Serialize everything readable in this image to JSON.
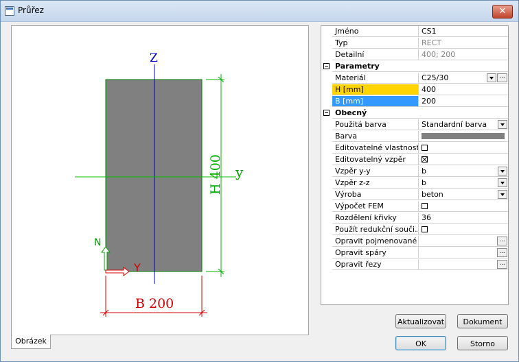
{
  "window": {
    "title": "Průřez",
    "close_label": "✕"
  },
  "drawing": {
    "axis_z": "Z",
    "axis_y": "y",
    "dim_height": "H 400",
    "dim_width": "B 200",
    "lcs_y": "Y",
    "lcs_z": "N",
    "colors": {
      "section": "#808080",
      "outline": "#008000",
      "z_axis": "#0000c0",
      "y_axis": "#00c000",
      "dim": "#00b000",
      "dim_b": "#d00000"
    }
  },
  "tab": {
    "label": "Obrázek"
  },
  "properties": {
    "rows": [
      {
        "type": "item",
        "name": "Jméno",
        "value": "CS1"
      },
      {
        "type": "item",
        "name": "Typ",
        "value": "RECT",
        "readonly": true
      },
      {
        "type": "item",
        "name": "Detailní",
        "value": "400; 200",
        "readonly": true
      },
      {
        "type": "category",
        "name": "Parametry"
      },
      {
        "type": "item",
        "name": "Materiál",
        "value": "C25/30",
        "dropdown": true,
        "dots": true
      },
      {
        "type": "item",
        "name": "H [mm]",
        "value": "400",
        "highlight": "yellow"
      },
      {
        "type": "item",
        "name": "B [mm]",
        "value": "200",
        "highlight": "blue"
      },
      {
        "type": "category",
        "name": "Obecný"
      },
      {
        "type": "item",
        "name": "Použitá barva",
        "value": "Standardní barva",
        "dropdown": true
      },
      {
        "type": "item",
        "name": "Barva",
        "swatch": true
      },
      {
        "type": "item",
        "name": "Editovatelné vlastnosti",
        "checkbox": false
      },
      {
        "type": "item",
        "name": "Editovatelný vzpěr",
        "checkbox": true
      },
      {
        "type": "item",
        "name": "Vzpěr y-y",
        "value": "b",
        "dropdown": true
      },
      {
        "type": "item",
        "name": "Vzpěr z-z",
        "value": "b",
        "dropdown": true
      },
      {
        "type": "item",
        "name": "Výroba",
        "value": "beton",
        "dropdown": true
      },
      {
        "type": "item",
        "name": "Výpočet FEM",
        "checkbox": false
      },
      {
        "type": "item",
        "name": "Rozdělení křivky",
        "value": "36"
      },
      {
        "type": "item",
        "name": "Použít redukční souči...",
        "checkbox": false
      },
      {
        "type": "item",
        "name": "Opravit pojmenované ...",
        "dots": true
      },
      {
        "type": "item",
        "name": "Opravit spáry",
        "dots": true
      },
      {
        "type": "item",
        "name": "Opravit řezy",
        "dots": true
      }
    ],
    "dots_label": "...",
    "colors": {
      "yellow": "#ffd400",
      "blue": "#3399ff",
      "swatch": "#808080"
    }
  },
  "buttons": {
    "update": "Aktualizovat",
    "document": "Dokument",
    "ok": "OK",
    "cancel": "Storno"
  }
}
